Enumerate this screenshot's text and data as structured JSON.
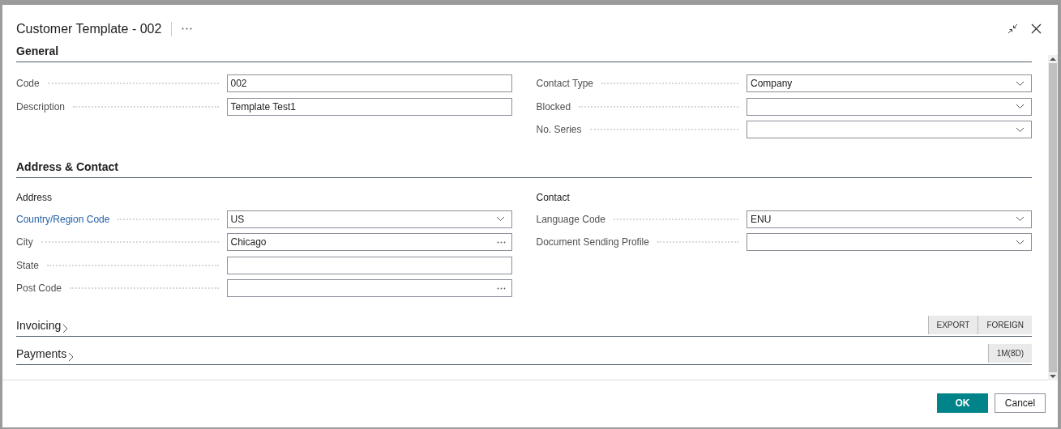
{
  "dialog": {
    "title": "Customer Template - 002"
  },
  "sections": [
    {
      "title": "General",
      "expanded": true,
      "columns": [
        {
          "fields": [
            {
              "label": "Code",
              "value": "002",
              "kind": "text",
              "link": false
            },
            {
              "label": "Description",
              "value": "Template Test1",
              "kind": "text",
              "link": false
            }
          ]
        },
        {
          "fields": [
            {
              "label": "Contact Type",
              "value": "Company",
              "kind": "dropdown",
              "link": false
            },
            {
              "label": "Blocked",
              "kind": "dropdown",
              "link": false
            },
            {
              "label": "No. Series",
              "kind": "dropdown",
              "link": false
            }
          ]
        }
      ]
    },
    {
      "title": "Address & Contact",
      "expanded": true,
      "columns": [
        {
          "heading": "Address",
          "fields": [
            {
              "label": "Country/Region Code",
              "value": "US",
              "kind": "dropdown",
              "link": true
            },
            {
              "label": "City",
              "value": "Chicago",
              "kind": "lookup",
              "link": false
            },
            {
              "label": "State",
              "kind": "text",
              "link": false
            },
            {
              "label": "Post Code",
              "kind": "lookup",
              "link": false
            }
          ]
        },
        {
          "heading": "Contact",
          "fields": [
            {
              "label": "Language Code",
              "value": "ENU",
              "kind": "dropdown",
              "link": false
            },
            {
              "label": "Document Sending Profile",
              "kind": "dropdown",
              "link": false
            }
          ]
        }
      ]
    },
    {
      "title": "Invoicing",
      "expanded": false,
      "tags": [
        "EXPORT",
        "FOREIGN"
      ]
    },
    {
      "title": "Payments",
      "expanded": false,
      "tags": [
        "1M(8D)"
      ]
    }
  ],
  "buttons": [
    {
      "label": "OK",
      "primary": true
    },
    {
      "label": "Cancel",
      "primary": false
    }
  ]
}
